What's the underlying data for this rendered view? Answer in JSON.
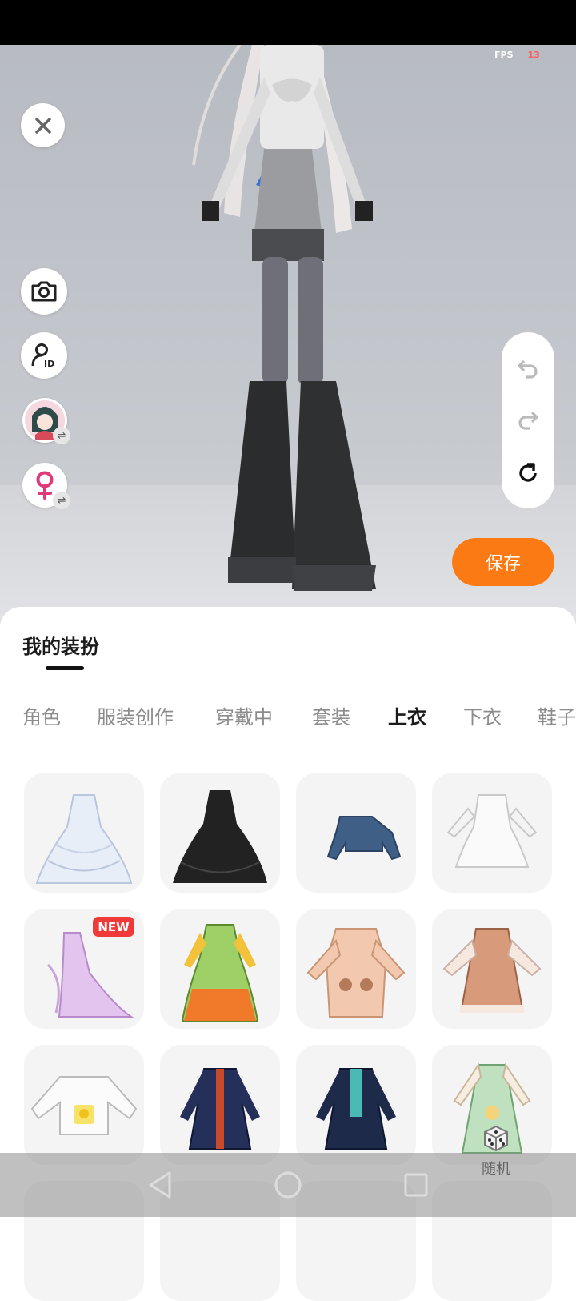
{
  "fps": {
    "label": "FPS",
    "value": "13"
  },
  "save_label": "保存",
  "sheet": {
    "title": "我的装扮",
    "tabs": [
      "角色",
      "服装创作",
      "穿戴中",
      "套装",
      "上衣",
      "下衣",
      "鞋子"
    ],
    "active_tab": "上衣"
  },
  "items": [
    {
      "name": "white-layered-gown"
    },
    {
      "name": "black-layered-gown"
    },
    {
      "name": "denim-crop-jacket"
    },
    {
      "name": "white-lace-dress"
    },
    {
      "name": "purple-gradient-gown",
      "badge": "NEW"
    },
    {
      "name": "green-orange-hanfu"
    },
    {
      "name": "peach-bear-hoodie"
    },
    {
      "name": "brown-bear-dress"
    },
    {
      "name": "duck-pocket-shirt"
    },
    {
      "name": "navy-red-coat"
    },
    {
      "name": "navy-teal-coat"
    },
    {
      "name": "green-floral-dress"
    }
  ],
  "random_label": "随机",
  "colors": {
    "accent": "#fb7a14",
    "new_badge": "#f03a3a"
  }
}
